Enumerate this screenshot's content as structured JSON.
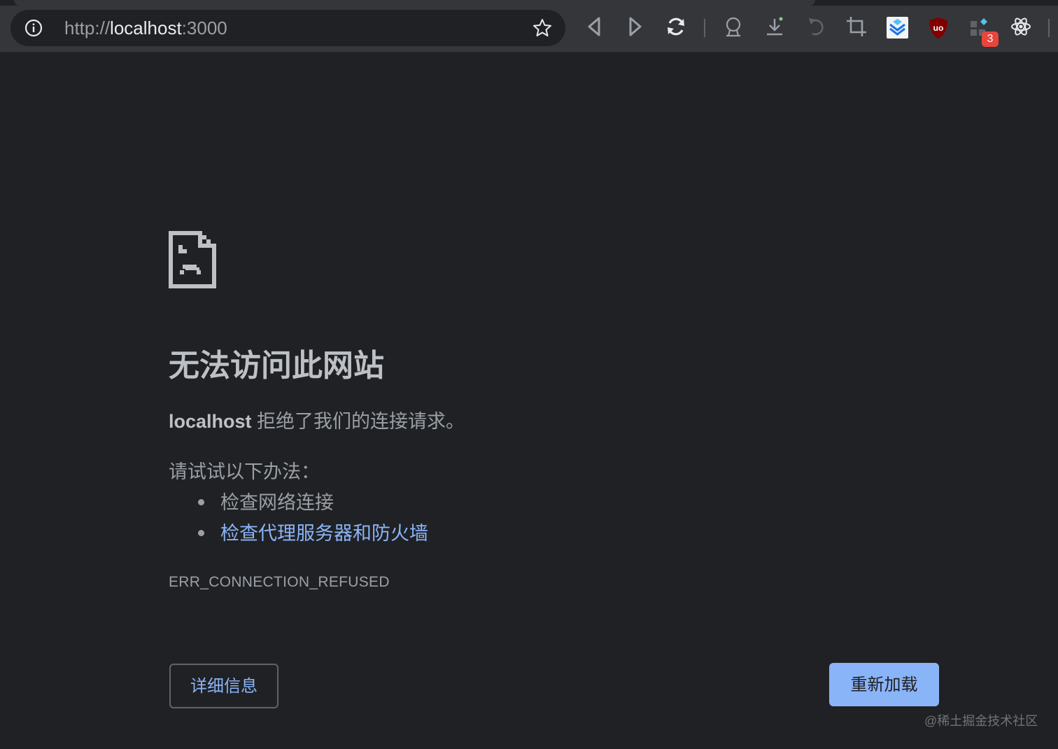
{
  "browser": {
    "url_scheme": "http://",
    "url_host": "localhost",
    "url_port": ":3000",
    "extension_badge": "3",
    "icons": [
      "info-icon",
      "star-icon",
      "back-icon",
      "forward-icon",
      "reload-icon",
      "profile-icon",
      "download-icon",
      "undo-icon",
      "crop-icon",
      "stack-extension-icon",
      "ublock-icon",
      "extensions-icon",
      "react-devtools-icon"
    ],
    "ublock_label": "uo"
  },
  "error_page": {
    "title": "无法访问此网站",
    "description_host": "localhost",
    "description_text": " 拒绝了我们的连接请求。",
    "try_label": "请试试以下办法：",
    "suggestions": [
      {
        "text": "检查网络连接"
      },
      {
        "text": "检查代理服务器和防火墙"
      }
    ],
    "error_code": "ERR_CONNECTION_REFUSED",
    "details_button": "详细信息",
    "reload_button": "重新加载"
  },
  "watermark": "@稀土掘金技术社区",
  "colors": {
    "background": "#202124",
    "toolbar": "#35363a",
    "link": "#8ab4f8",
    "text": "#9aa0a6",
    "title": "#bdc1c6",
    "badge": "#e8453c"
  }
}
